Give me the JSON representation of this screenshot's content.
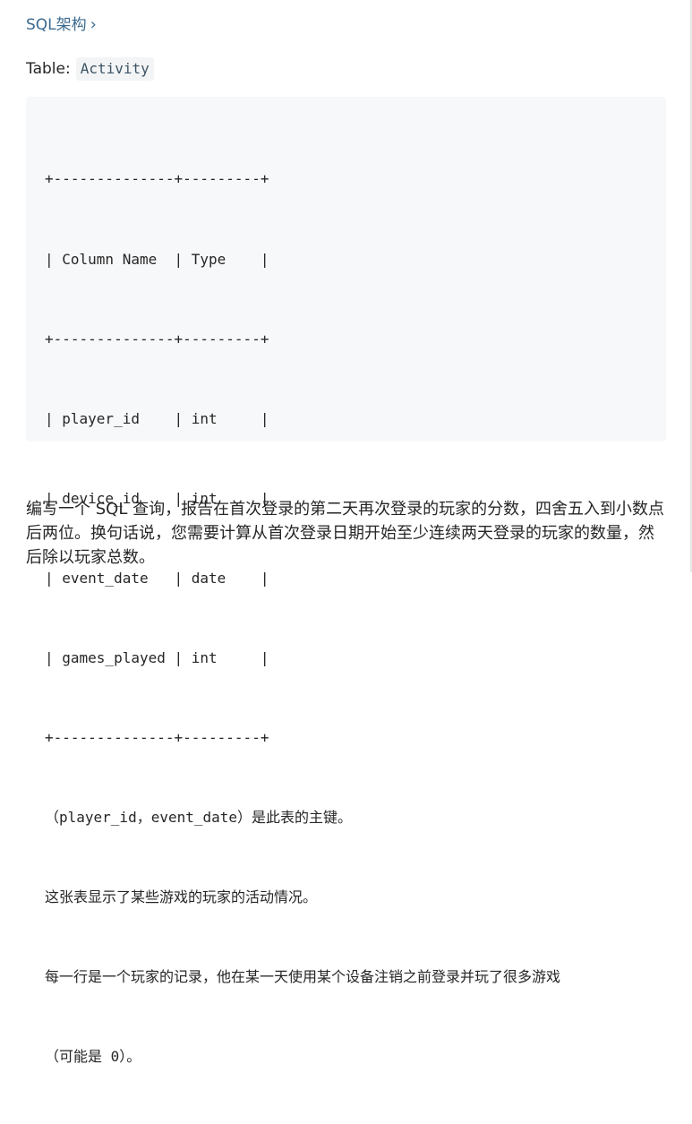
{
  "schema_link": {
    "label": "SQL架构",
    "chevron": "›"
  },
  "table_line": {
    "label": "Table:",
    "table_name": "Activity"
  },
  "code_lines": [
    "+--------------+---------+",
    "| Column Name  | Type    |",
    "+--------------+---------+",
    "| player_id    | int     |",
    "| device_id    | int     |",
    "| event_date   | date    |",
    "| games_played | int     |",
    "+--------------+---------+",
    "（player_id，event_date）是此表的主键。",
    "这张表显示了某些游戏的玩家的活动情况。",
    "每一行是一个玩家的记录，他在某一天使用某个设备注销之前登录并玩了很多游戏",
    "（可能是 0）。"
  ],
  "description": "编写一个 SQL 查询，报告在首次登录的第二天再次登录的玩家的分数，四舍五入到小数点后两位。换句话说，您需要计算从首次登录日期开始至少连续两天登录的玩家的数量，然后除以玩家总数。",
  "colors": {
    "link": "#3c6a8f",
    "code_background": "#f7f8fa",
    "chip_background": "#f3f4f5",
    "text": "#262626"
  }
}
